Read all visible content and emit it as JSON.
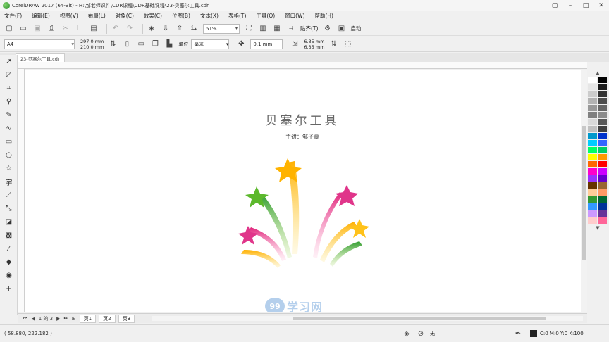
{
  "window": {
    "title": "CorelDRAW 2017 (64-Bit) - H:\\邹老师课件\\CDR课程\\CDR基础课程\\23-贝塞尔工具.cdr",
    "controls": [
      "▢",
      "–",
      "□",
      "✕"
    ]
  },
  "menu": [
    {
      "label": "文件(F)"
    },
    {
      "label": "编辑(E)"
    },
    {
      "label": "视图(V)"
    },
    {
      "label": "布局(L)"
    },
    {
      "label": "对象(C)"
    },
    {
      "label": "效果(C)"
    },
    {
      "label": "位图(B)"
    },
    {
      "label": "文本(X)"
    },
    {
      "label": "表格(T)"
    },
    {
      "label": "工具(O)"
    },
    {
      "label": "窗口(W)"
    },
    {
      "label": "帮助(H)"
    }
  ],
  "standard_toolbar": {
    "zoom": "51%",
    "snap_label": "贴齐(T)",
    "launch_label": "启动"
  },
  "property_bar": {
    "page_size": "A4",
    "width": "297.0 mm",
    "height": "210.0 mm",
    "units_label": "单位",
    "units_value": "毫米",
    "nudge": "0.1 mm",
    "dup_x": "6.35 mm",
    "dup_y": "6.35 mm"
  },
  "document_tab": "23-贝塞尔工具.cdr",
  "document": {
    "title": "贝塞尔工具",
    "subtitle": "主讲：邹子豪",
    "watermark": "学习网"
  },
  "page_navigator": {
    "position": "1 的 3",
    "tabs": [
      "页1",
      "页2",
      "页3"
    ]
  },
  "status": {
    "coords": "( 58.880, 222.182 )",
    "fill_none": "无",
    "outline": "C:0 M:0 Y:0 K:100"
  },
  "palette_colors": [
    "#ffffff",
    "#000000",
    "#e6e6e6",
    "#1a1a1a",
    "#cccccc",
    "#333333",
    "#b3b3b3",
    "#4d4d4d",
    "#999999",
    "#666666",
    "#808080",
    "#8c8c8c",
    "#d9d9d9",
    "#595959",
    "#c0c0c0",
    "#404040",
    "#0099cc",
    "#0033cc",
    "#00ccff",
    "#3366ff",
    "#00ff66",
    "#00cc66",
    "#ffff00",
    "#ff9900",
    "#ff6600",
    "#ff0000",
    "#ff00cc",
    "#cc00ff",
    "#9933ff",
    "#6600cc",
    "#663300",
    "#996633",
    "#ffcc99",
    "#ff9966",
    "#339933",
    "#006633",
    "#3399ff",
    "#003399",
    "#cc99ff",
    "#663399",
    "#ffcccc",
    "#ff6699"
  ]
}
